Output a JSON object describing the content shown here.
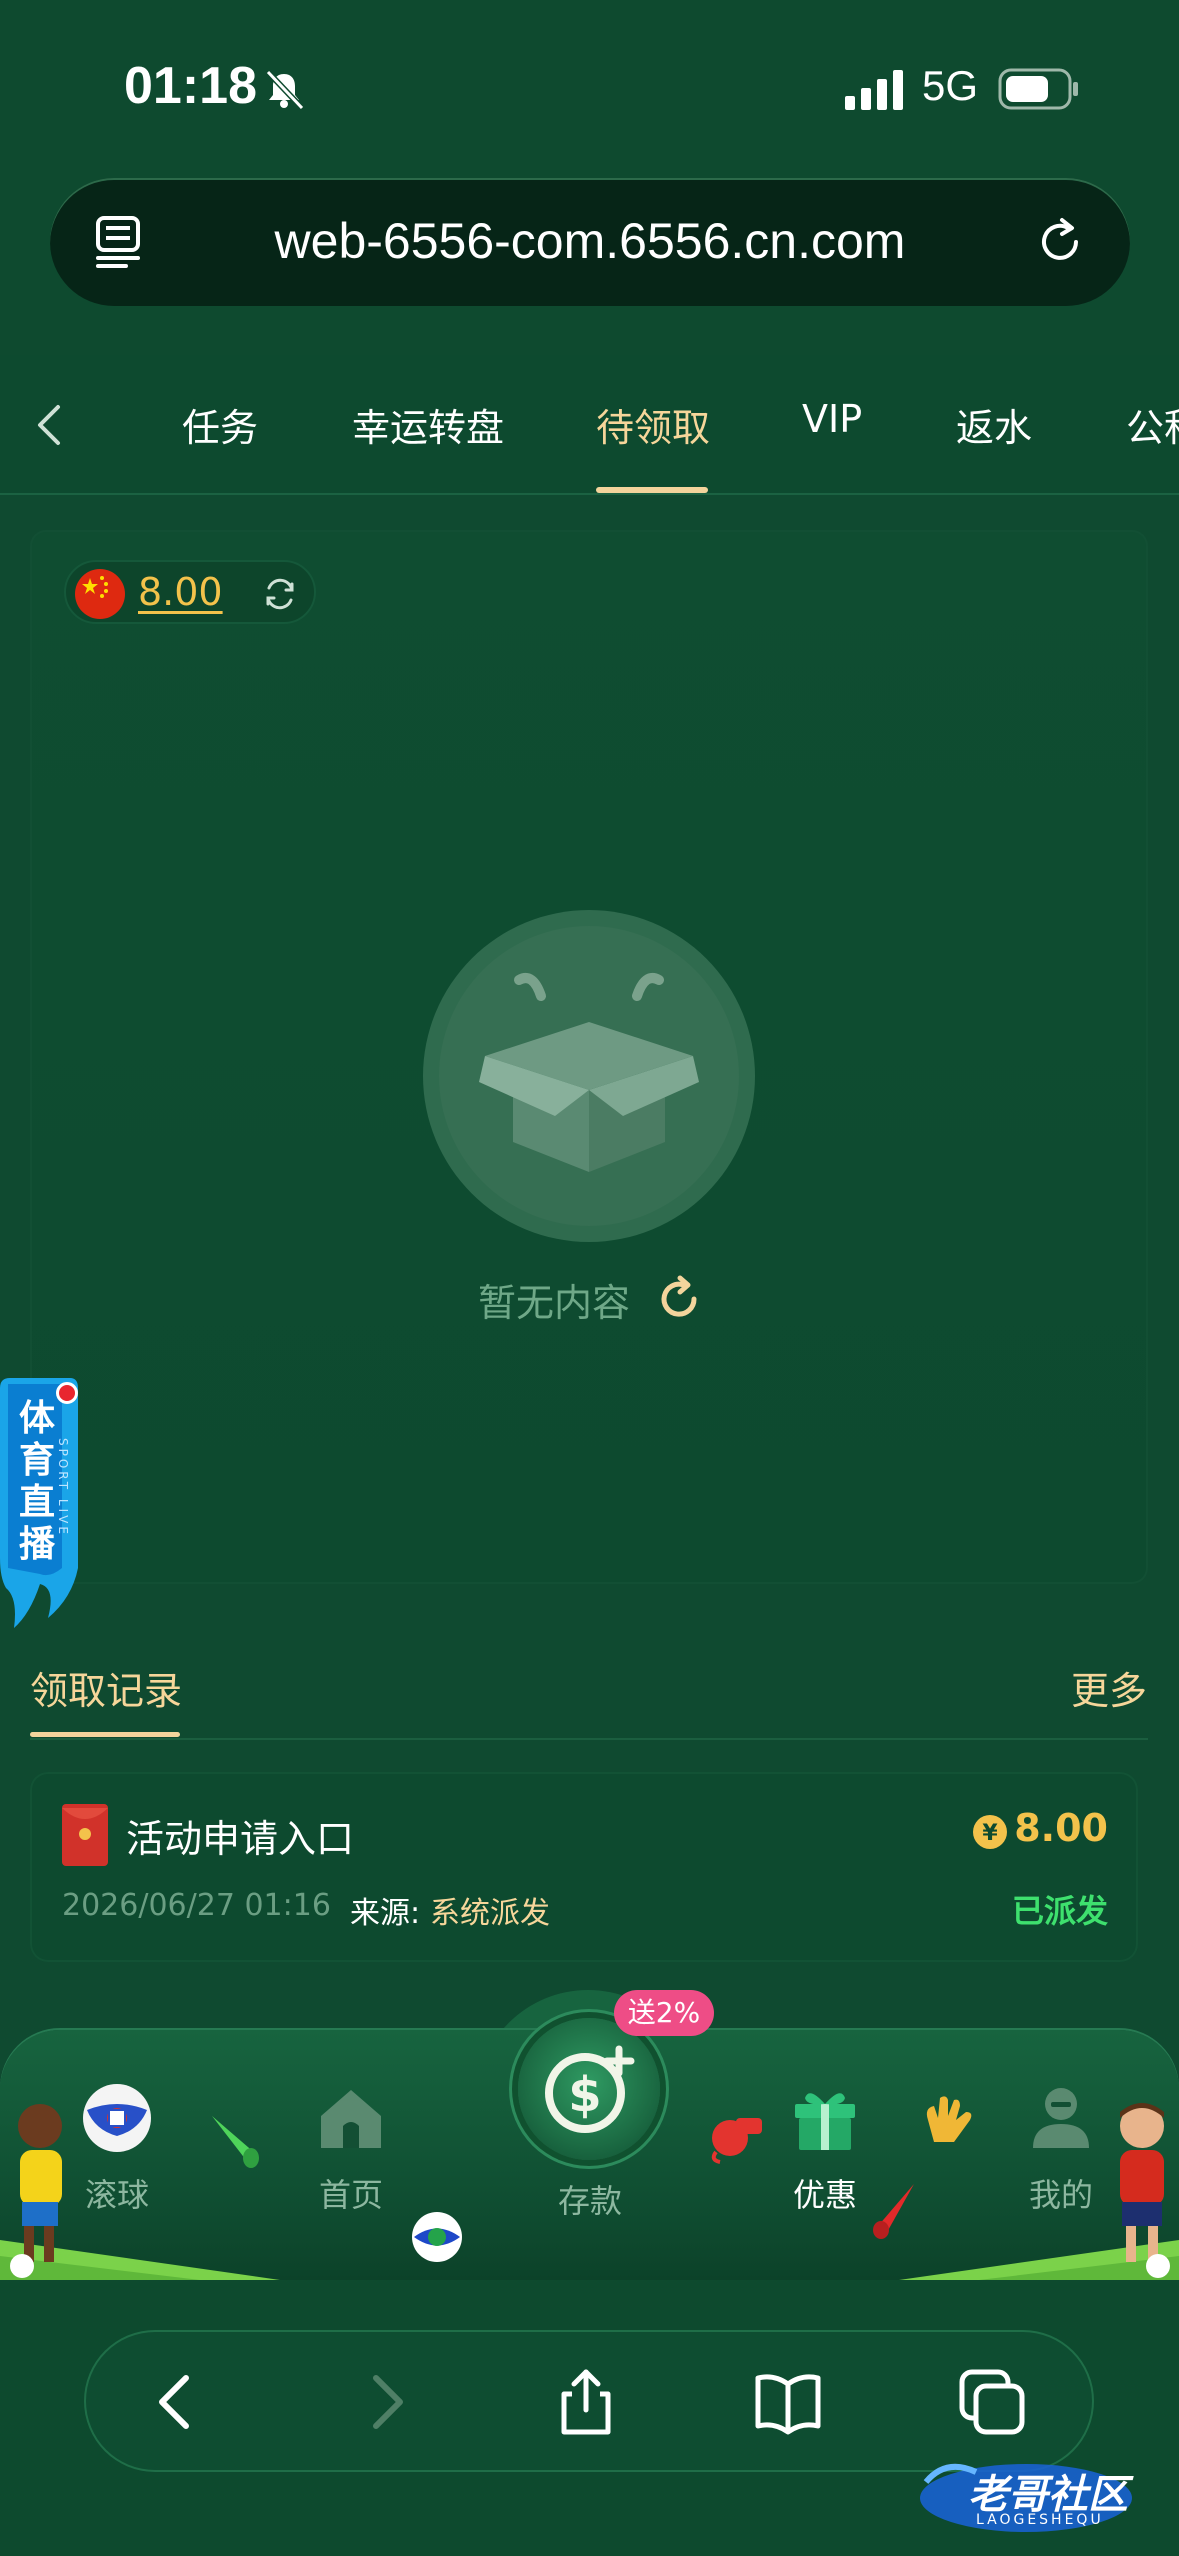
{
  "status_bar": {
    "time": "01:18",
    "network": "5G"
  },
  "browser": {
    "url": "web-6556-com.6556.cn.com"
  },
  "tabs": [
    {
      "label": "任务"
    },
    {
      "label": "幸运转盘"
    },
    {
      "label": "待领取"
    },
    {
      "label": "VIP"
    },
    {
      "label": "返水"
    },
    {
      "label": "公积"
    }
  ],
  "balance": {
    "value": "8.00"
  },
  "empty_state": {
    "text": "暂无内容"
  },
  "sport_live": {
    "label": "体育直播",
    "sub": "SPORT LIVE"
  },
  "records": {
    "title": "领取记录",
    "more": "更多",
    "items": [
      {
        "title": "活动申请入口",
        "amount": "8.00",
        "date": "2026/06/27 01:16",
        "source_label": "来源:",
        "source": "系统派发",
        "status": "已派发"
      }
    ]
  },
  "bottom_nav": {
    "items": [
      {
        "label": "滚球"
      },
      {
        "label": "首页"
      },
      {
        "label": "存款"
      },
      {
        "label": "优惠"
      },
      {
        "label": "我的"
      }
    ],
    "deposit_badge": "送2%"
  },
  "watermark": {
    "text": "老哥社区",
    "sub": "LAOGESHEQU"
  },
  "colors": {
    "accent_gold": "#f3c24b",
    "tab_active": "#f6d69a",
    "status_green": "#3ee06e",
    "background": "#0f4a30"
  }
}
